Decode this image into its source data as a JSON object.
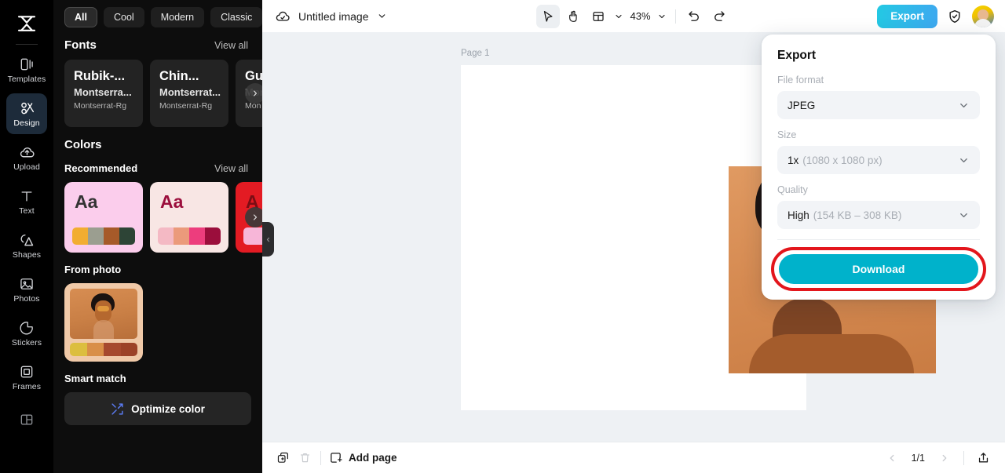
{
  "rail": {
    "logo_icon": "capcut-logo-icon",
    "items": [
      {
        "label": "Templates",
        "icon": "templates-icon",
        "active": false
      },
      {
        "label": "Design",
        "icon": "design-icon",
        "active": true
      },
      {
        "label": "Upload",
        "icon": "upload-cloud-icon",
        "active": false
      },
      {
        "label": "Text",
        "icon": "text-icon",
        "active": false
      },
      {
        "label": "Shapes",
        "icon": "shapes-icon",
        "active": false
      },
      {
        "label": "Photos",
        "icon": "photos-icon",
        "active": false
      },
      {
        "label": "Stickers",
        "icon": "stickers-icon",
        "active": false
      },
      {
        "label": "Frames",
        "icon": "frames-icon",
        "active": false
      }
    ]
  },
  "panel": {
    "chips": [
      {
        "label": "All",
        "selected": true
      },
      {
        "label": "Cool",
        "selected": false
      },
      {
        "label": "Modern",
        "selected": false
      },
      {
        "label": "Classic",
        "selected": false
      }
    ],
    "chip_more_icon": "chevron-down-icon",
    "fonts": {
      "title": "Fonts",
      "view_all": "View all",
      "cards": [
        {
          "line1": "Rubik-...",
          "line2": "Montserra...",
          "line3": "Montserrat-Rg"
        },
        {
          "line1": "Chin...",
          "line2": "Montserrat...",
          "line3": "Montserrat-Rg"
        },
        {
          "line1": "Gu",
          "line2": "Mor",
          "line3": "Mon"
        }
      ]
    },
    "colors": {
      "title": "Colors",
      "recommended_label": "Recommended",
      "view_all": "View all",
      "palettes": [
        {
          "aa": "Aa",
          "bg": "#fbcdec",
          "text": "#333333",
          "swatches": [
            "#f2ad31",
            "#9b9e90",
            "#a65a29",
            "#2d4436"
          ]
        },
        {
          "aa": "Aa",
          "bg": "#f8e6e4",
          "text": "#9b0e3c",
          "swatches": [
            "#f4b9c4",
            "#eb9a7b",
            "#ed3d7d",
            "#9b0e3c"
          ]
        },
        {
          "aa": "A",
          "bg": "#e31b23",
          "text": "#7a0d14",
          "swatches": [
            "#f7b6d8",
            "#f7b6d8",
            "#f7b6d8",
            "#f7b6d8"
          ]
        }
      ],
      "carousel_next_icon": "chevron-right-icon"
    },
    "from_photo": {
      "title": "From photo",
      "swatches": [
        "#dcbe3f",
        "#d98f48",
        "#a6492e",
        "#9c4228"
      ]
    },
    "smart_match": {
      "title": "Smart match",
      "button_label": "Optimize color",
      "button_icon": "shuffle-icon"
    },
    "collapse_icon": "chevron-left-icon"
  },
  "topbar": {
    "cloud_icon": "cloud-check-icon",
    "doc_name": "Untitled image",
    "doc_chevron_icon": "chevron-down-icon",
    "tools": [
      {
        "name": "select-tool",
        "icon": "cursor-arrow-icon",
        "selected": true
      },
      {
        "name": "hand-tool",
        "icon": "hand-icon",
        "selected": false
      },
      {
        "name": "layout-tool",
        "icon": "layout-panel-icon",
        "selected": false
      }
    ],
    "layout_chevron_icon": "chevron-down-icon",
    "zoom_level": "43%",
    "zoom_chevron_icon": "chevron-down-icon",
    "undo_icon": "undo-icon",
    "redo_icon": "redo-icon",
    "export_label": "Export",
    "shield_icon": "shield-check-icon",
    "avatar_icon": "user-avatar"
  },
  "canvas": {
    "page_label": "Page 1"
  },
  "bottombar": {
    "duplicate_icon": "duplicate-page-icon",
    "delete_icon": "trash-icon",
    "add_page_label": "Add page",
    "add_page_icon": "square-plus-icon",
    "prev_icon": "chevron-left-icon",
    "page_indicator": "1/1",
    "next_icon": "chevron-right-icon",
    "share_icon": "upload-box-icon"
  },
  "export_popover": {
    "title": "Export",
    "file_format": {
      "label": "File format",
      "value": "JPEG",
      "chevron_icon": "chevron-down-icon"
    },
    "size": {
      "label": "Size",
      "value": "1x",
      "detail": "(1080 x 1080 px)",
      "chevron_icon": "chevron-down-icon"
    },
    "quality": {
      "label": "Quality",
      "value": "High",
      "detail": "(154 KB – 308 KB)",
      "chevron_icon": "chevron-down-icon"
    },
    "download_label": "Download",
    "highlight_color": "#e3161c",
    "download_color": "#00b2cb"
  }
}
